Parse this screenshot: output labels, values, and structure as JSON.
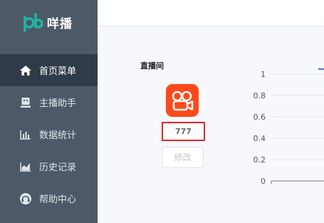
{
  "app": {
    "name": "咩播",
    "logo_icon": "pb-logo-icon",
    "accent": "#1fb5a3"
  },
  "sidebar": {
    "bg": "#4d5967",
    "active_bg": "#2f3b49",
    "items": [
      {
        "label": "首页菜单",
        "icon": "home-icon",
        "active": true
      },
      {
        "label": "主播助手",
        "icon": "assistant-icon",
        "active": false
      },
      {
        "label": "数据统计",
        "icon": "bar-chart-icon",
        "active": false
      },
      {
        "label": "历史记录",
        "icon": "area-chart-icon",
        "active": false
      },
      {
        "label": "帮助中心",
        "icon": "headset-icon",
        "active": false
      }
    ]
  },
  "room": {
    "title": "直播间",
    "platform_icon": "kuaishou-icon",
    "platform_color": "#fe4a1a",
    "room_id": "777",
    "edit_label": "修改"
  },
  "chart_data": {
    "type": "line",
    "y_ticks": [
      "1",
      "0.8",
      "0.6",
      "0.4",
      "0.2",
      "0"
    ],
    "ylim": [
      0,
      1
    ],
    "grid": true
  }
}
